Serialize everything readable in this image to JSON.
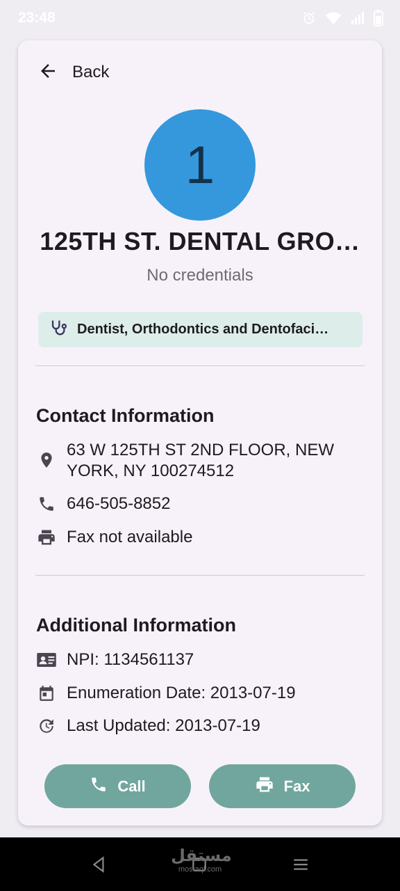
{
  "status_bar": {
    "time": "23:48",
    "icons": [
      "alarm-icon",
      "wifi-icon",
      "signal-icon",
      "battery-icon"
    ]
  },
  "header": {
    "back_label": "Back"
  },
  "provider": {
    "avatar_text": "1",
    "name": "125TH ST. DENTAL GRO…",
    "credentials": "No credentials",
    "taxonomy": "Dentist, Orthodontics and Dentofaci…"
  },
  "contact": {
    "title": "Contact Information",
    "address_line1": "63 W 125TH ST 2ND FLOOR, NEW",
    "address_line2": "YORK, NY 100274512",
    "phone": "646-505-8852",
    "fax": "Fax not available"
  },
  "additional": {
    "title": "Additional Information",
    "npi": "NPI: 1134561137",
    "enumeration_date": "Enumeration Date: 2013-07-19",
    "last_updated": "Last Updated: 2013-07-19"
  },
  "actions": {
    "call_label": "Call",
    "fax_label": "Fax"
  },
  "watermark": {
    "top": "مستقل",
    "bottom": "mostaql.com"
  },
  "colors": {
    "avatar": "#3598dc",
    "chip_bg": "#ddeeea",
    "button": "#71a69e",
    "card_bg": "#f7f2f9"
  }
}
